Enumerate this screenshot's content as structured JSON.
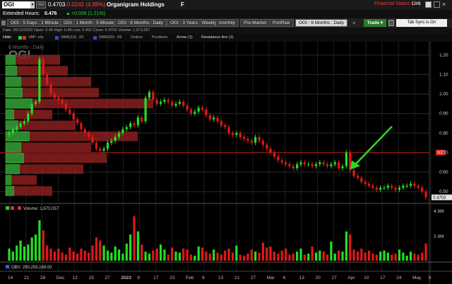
{
  "header": {
    "symbol": "OGI",
    "badge": "OGI",
    "last_price": "0.4703",
    "change": "-0.0242 (4.89%)",
    "company": "Organigram Holdings",
    "flag": "F",
    "financial_status": "Financial Status: D",
    "link_label": "Link"
  },
  "extended": {
    "label": "Extended Hours:",
    "price": "0.476",
    "arrow": "▲",
    "change": "+0.006 (1.21%)"
  },
  "tabs": [
    {
      "label": "OGI : 5 Days : 1 Minute"
    },
    {
      "label": "OGI : 1 Month : 5 Minute"
    },
    {
      "label": "OGI : 6 Months : Daily"
    },
    {
      "label": "OGI : 3 Years : Weekly"
    },
    {
      "label": "monthly"
    },
    {
      "label": "Pre-Market"
    },
    {
      "label": "PortRisk"
    },
    {
      "label": "OGI : 6 Months : Daily"
    }
  ],
  "trade_label": "Trade ▾",
  "tab_sync": "Tab Sync is On",
  "info": "Date: 05/12/2023   Open: 0.49   High: 0.49   Low: 0.462   Close: 0.4703   Volume: 1,673,057",
  "toolbar": {
    "hide": "Hide:",
    "vap": "VAP: n/a",
    "sma10": "SMA(10): .50",
    "sma50": "SMA(50): .69",
    "orders": "Orders",
    "positions": "Positions",
    "arrow": "Arrow (1)",
    "resistance": "Resistance line (1)"
  },
  "chart_data": {
    "type": "candlestick",
    "watermark_symbol": "OGI",
    "watermark_period": "6 Months : Daily",
    "y_ticks": [
      "1.20",
      "1.10",
      "1.00",
      "0.90",
      "0.80",
      "0.70",
      "0.60",
      "0.50"
    ],
    "ylim": [
      0.45,
      1.25
    ],
    "resistance_level": 0.7,
    "resistance_label": "0.7",
    "last_price_label": "0.4703",
    "x_labels": [
      "14",
      "21",
      "28",
      "Dec",
      "12",
      "19",
      "27",
      "2023",
      "9",
      "17",
      "23",
      "Feb",
      "6",
      "13",
      "21",
      "27",
      "Mar",
      "6",
      "13",
      "20",
      "27",
      "Apr",
      "10",
      "17",
      "24",
      "May",
      "8"
    ],
    "close": [
      0.8,
      0.82,
      0.83,
      0.85,
      0.86,
      0.9,
      0.95,
      0.96,
      1.18,
      1.1,
      1.05,
      1.0,
      0.98,
      0.97,
      0.95,
      0.92,
      0.9,
      0.87,
      0.85,
      0.82,
      0.8,
      0.78,
      0.75,
      0.72,
      0.71,
      0.72,
      0.75,
      0.76,
      0.78,
      0.8,
      0.82,
      0.83,
      0.85,
      0.84,
      0.88,
      0.86,
      0.98,
      1.01,
      0.97,
      0.95,
      0.96,
      0.97,
      0.96,
      0.94,
      0.95,
      0.96,
      0.94,
      0.92,
      0.9,
      0.91,
      0.93,
      0.92,
      0.89,
      0.87,
      0.88,
      0.86,
      0.84,
      0.83,
      0.8,
      0.79,
      0.8,
      0.78,
      0.77,
      0.76,
      0.75,
      0.78,
      0.76,
      0.74,
      0.72,
      0.7,
      0.68,
      0.66,
      0.65,
      0.64,
      0.63,
      0.62,
      0.64,
      0.65,
      0.64,
      0.64,
      0.63,
      0.64,
      0.65,
      0.64,
      0.63,
      0.64,
      0.65,
      0.62,
      0.63,
      0.7,
      0.61,
      0.58,
      0.57,
      0.55,
      0.54,
      0.53,
      0.52,
      0.51,
      0.52,
      0.52,
      0.53,
      0.52,
      0.51,
      0.52,
      0.53,
      0.53,
      0.54,
      0.53,
      0.52,
      0.5,
      0.47
    ],
    "volume_label": "Volume: 1,673,057",
    "volume_ticks": [
      "4.9M",
      "2.4M"
    ],
    "volume_max_millions": 4.9,
    "volume_millions": [
      1.2,
      0.9,
      1.5,
      2.0,
      1.4,
      1.6,
      2.3,
      2.6,
      4.0,
      3.0,
      1.5,
      1.2,
      0.9,
      1.2,
      0.8,
      0.6,
      1.3,
      0.9,
      0.7,
      1.2,
      1.0,
      0.8,
      1.5,
      2.3,
      2.0,
      1.5,
      1.0,
      0.8,
      1.4,
      1.1,
      0.7,
      1.7,
      2.6,
      4.4,
      2.9,
      1.6,
      0.9,
      0.7,
      1.0,
      1.2,
      1.6,
      1.1,
      0.6,
      1.3,
      0.9,
      0.8,
      1.2,
      1.1,
      0.6,
      0.5,
      1.4,
      1.3,
      0.9,
      0.7,
      1.1,
      0.8,
      0.6,
      1.0,
      1.2,
      0.8,
      1.5,
      0.6,
      0.5,
      0.7,
      1.1,
      0.9,
      0.8,
      1.8,
      1.3,
      1.4,
      0.9,
      0.7,
      1.0,
      1.2,
      0.6,
      0.7,
      0.9,
      1.2,
      0.6,
      0.7,
      1.4,
      0.8,
      1.0,
      0.9,
      0.6,
      1.9,
      0.7,
      1.0,
      0.9,
      2.9,
      2.6,
      1.1,
      0.9,
      1.2,
      0.8,
      1.0,
      0.7,
      0.6,
      0.9,
      1.0,
      0.8,
      0.6,
      0.7,
      1.1,
      0.8,
      0.5,
      0.9,
      0.7,
      0.6,
      0.8,
      1.7
    ],
    "obv_label": "OBV: 290,259,169.00",
    "vap_profile": [
      0.35,
      0.4,
      0.55,
      0.6,
      0.95,
      0.3,
      0.45,
      0.85,
      0.55,
      0.65,
      0.5,
      0.2,
      0.3
    ]
  },
  "colors": {
    "up": "#22e022",
    "down": "#e01818",
    "resistance": "#cc2222",
    "arrow": "#22dd22",
    "vap_up": "#2e8a2e",
    "vap_down": "#8a1e1e"
  }
}
